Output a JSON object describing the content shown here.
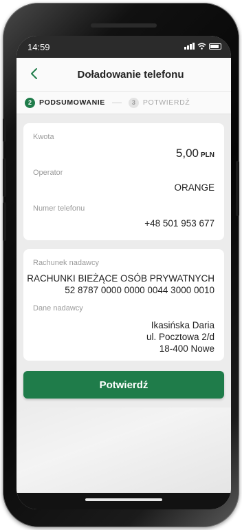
{
  "status_bar": {
    "time": "14:59"
  },
  "header": {
    "title": "Doładowanie telefonu"
  },
  "steps": [
    {
      "number": "2",
      "label": "PODSUMOWANIE",
      "active": true
    },
    {
      "number": "3",
      "label": "POTWIERDŹ",
      "active": false
    }
  ],
  "summary": {
    "amount_label": "Kwota",
    "amount_value": "5,00",
    "amount_currency": "PLN",
    "operator_label": "Operator",
    "operator_value": "ORANGE",
    "phone_label": "Numer telefonu",
    "phone_value": "+48 501 953 677"
  },
  "sender": {
    "account_label": "Rachunek nadawcy",
    "account_name": "RACHUNKI BIEŻĄCE OSÓB PRYWATNYCH",
    "account_number": "52 8787 0000 0000 0044 3000 0010",
    "data_label": "Dane nadawcy",
    "name": "Ikasińska Daria",
    "street": "ul. Pocztowa 2/d",
    "city": "18-400 Nowe"
  },
  "actions": {
    "confirm_label": "Potwierdź"
  },
  "colors": {
    "accent": "#1f7c4a",
    "background": "#ececec",
    "card": "#ffffff"
  }
}
